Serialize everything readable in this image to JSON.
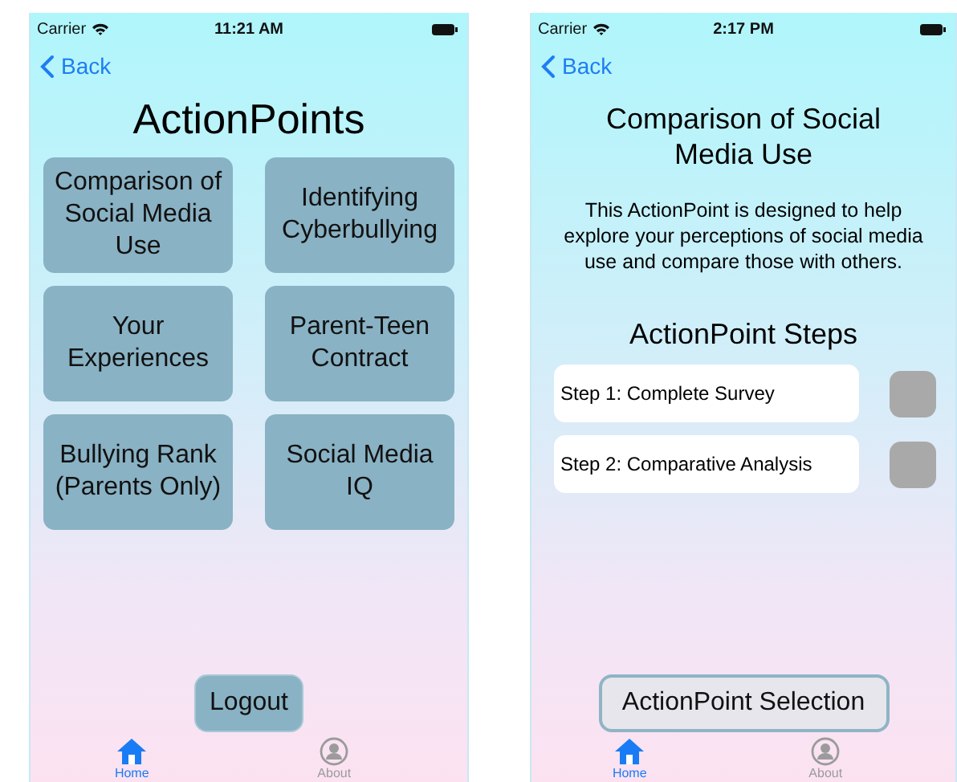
{
  "screens": [
    {
      "kind": "menu",
      "status_bar": {
        "carrier": "Carrier",
        "time": "11:21 AM"
      },
      "back": "Back",
      "title": "ActionPoints",
      "options": [
        "Comparison of Social Media Use",
        "Identifying Cyberbullying",
        "Your Experiences",
        "Parent-Teen Contract",
        "Bullying Rank (Parents Only)",
        "Social Media IQ"
      ],
      "bottom_button": "Logout",
      "tab_bar": [
        {
          "label": "Home",
          "selected": true
        },
        {
          "label": "About",
          "selected": false
        }
      ]
    },
    {
      "kind": "detail",
      "status_bar": {
        "carrier": "Carrier",
        "time": "2:17 PM"
      },
      "back": "Back",
      "title": "Comparison of Social Media Use",
      "description": "This ActionPoint is designed to help explore your perceptions of social media use and compare those with others.",
      "steps_heading": "ActionPoint Steps",
      "steps": [
        {
          "label": "Step 1: Complete Survey",
          "completed": false
        },
        {
          "label": "Step 2: Comparative Analysis",
          "completed": false
        }
      ],
      "bottom_button": "ActionPoint Selection",
      "tab_bar": [
        {
          "label": "Home",
          "selected": true
        },
        {
          "label": "About",
          "selected": false
        }
      ]
    }
  ]
}
